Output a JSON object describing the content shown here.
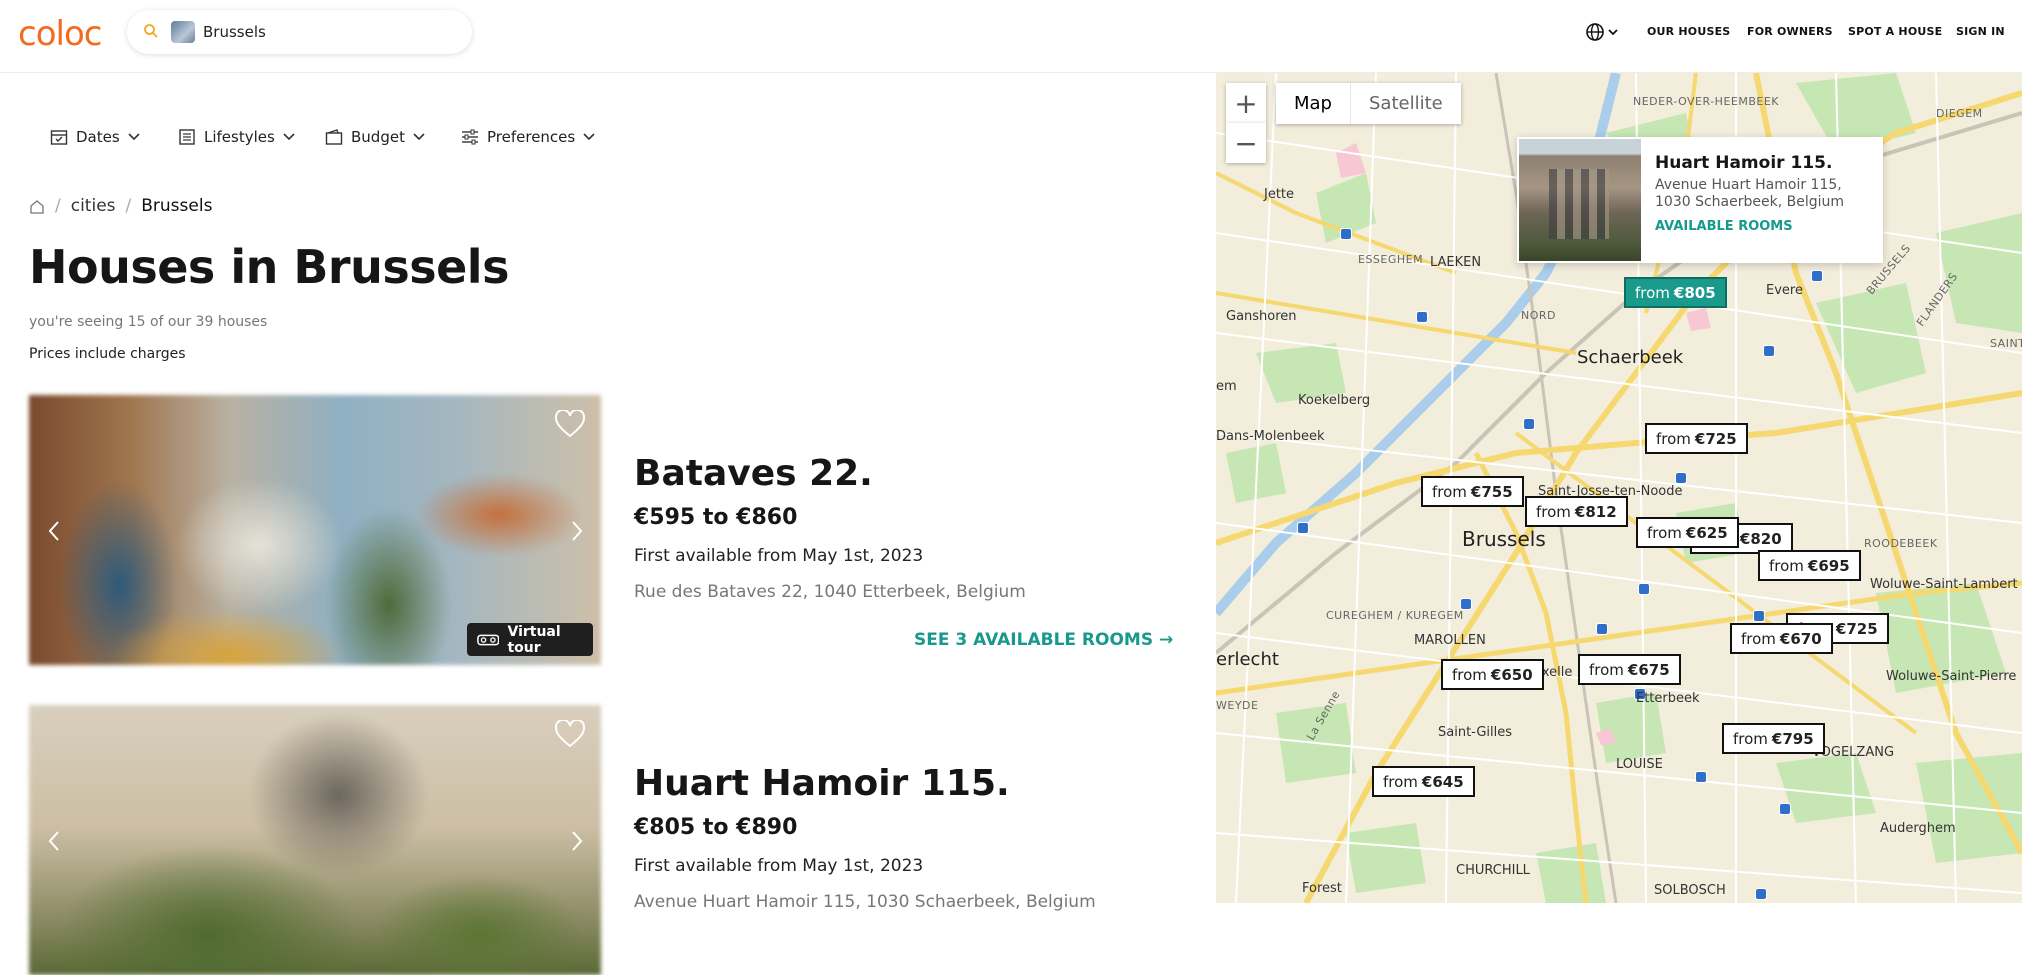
{
  "header": {
    "logo": "coloc",
    "search_value": "Brussels",
    "nav": [
      "OUR HOUSES",
      "FOR OWNERS",
      "SPOT A HOUSE",
      "SIGN IN"
    ]
  },
  "filters": [
    "Dates",
    "Lifestyles",
    "Budget",
    "Preferences"
  ],
  "breadcrumb": [
    "cities",
    "Brussels"
  ],
  "page_title": "Houses in Brussels",
  "count_text": "you're seeing 15 of our 39 houses",
  "prices_note": "Prices include charges",
  "houses": [
    {
      "title": "Bataves 22.",
      "range": "€595 to €860",
      "available": "First available from May 1st, 2023",
      "address": "Rue des Bataves 22, 1040 Etterbeek, Belgium",
      "link": "SEE 3 AVAILABLE ROOMS →",
      "badge": "Virtual tour"
    },
    {
      "title": "Huart Hamoir 115.",
      "range": "€805 to €890",
      "available": "First available from May 1st, 2023",
      "address": "Avenue Huart Hamoir 115, 1030 Schaerbeek, Belgium"
    }
  ],
  "map": {
    "types": [
      "Map",
      "Satellite"
    ],
    "popup": {
      "title": "Huart Hamoir 115.",
      "address": "Avenue Huart Hamoir 115, 1030 Schaerbeek, Belgium",
      "link": "AVAILABLE ROOMS"
    },
    "pins": [
      {
        "prefix": "from",
        "price": "€805"
      },
      {
        "prefix": "from",
        "price": "€725"
      },
      {
        "prefix": "from",
        "price": "€755"
      },
      {
        "prefix": "from",
        "price": "€812"
      },
      {
        "prefix": "from",
        "price": "€820"
      },
      {
        "prefix": "from",
        "price": "€625"
      },
      {
        "prefix": "from",
        "price": "€695"
      },
      {
        "prefix": "from",
        "price": "€725"
      },
      {
        "prefix": "from",
        "price": "€670"
      },
      {
        "prefix": "from",
        "price": "€675"
      },
      {
        "prefix": "from",
        "price": "€650"
      },
      {
        "prefix": "from",
        "price": "€795"
      },
      {
        "prefix": "from",
        "price": "€645"
      }
    ],
    "places": {
      "jette": "Jette",
      "ganshoren": "Ganshoren",
      "laeken": "LAEKEN",
      "esseghem": "ESSEGHEM",
      "nord": "NORD",
      "neder": "NEDER-OVER-HEEMBEEK",
      "diegem": "DIEGEM",
      "evere": "Evere",
      "schaerbeek": "Schaerbeek",
      "koekelberg": "Koekelberg",
      "molenbeek": "Dans-Molenbeek",
      "em": "em",
      "saintjosse": "Saint-Josse-ten-Noode",
      "brussels": "Brussels",
      "roodebeek": "ROODEBEEK",
      "wsl": "Woluwe-Saint-Lambert",
      "wsp": "Woluwe-Saint-Pierre",
      "cureghem": "CUREGHEM / KUREGEM",
      "marollen": "MAROLLEN",
      "erlecht": "erlecht",
      "weyde": "WEYDE",
      "ixelles": "Ixelle",
      "etterbeek": "Etterbeek",
      "saintgilles": "Saint-Gilles",
      "louise": "LOUISE",
      "vogelzang": "VOGELZANG",
      "auderghem": "Auderghem",
      "churchill": "CHURCHILL",
      "forest": "Forest",
      "solbosch": "SOLBOSCH",
      "lasenne": "La Senne",
      "flanders": "FLANDERS",
      "brusselsroad": "BRUSSELS",
      "saintst": "SAINT-ST"
    }
  }
}
